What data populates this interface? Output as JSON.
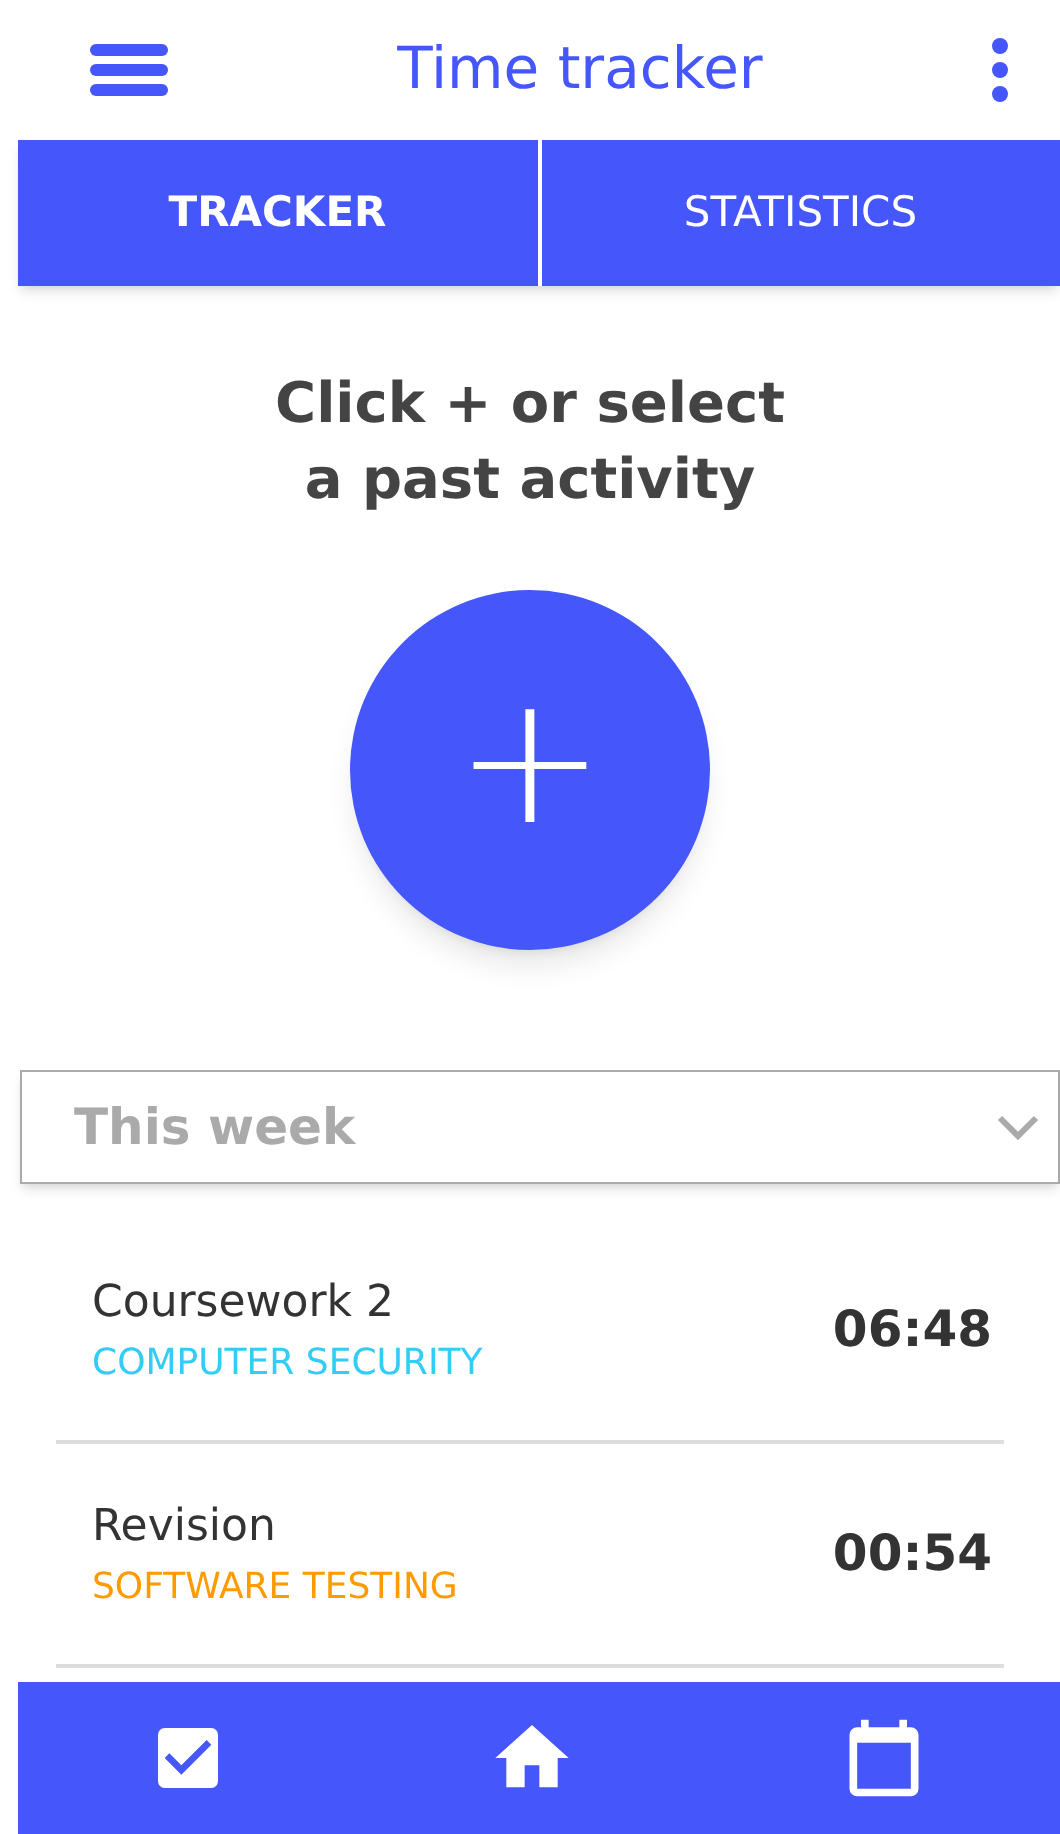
{
  "app_bar": {
    "title": "Time tracker"
  },
  "tabs": [
    {
      "label": "TRACKER",
      "selected": true
    },
    {
      "label": "STATISTICS",
      "selected": false
    }
  ],
  "prompt": "Click + or select\na past activity",
  "add_button": {
    "label": "+"
  },
  "period_select": {
    "value": "This week"
  },
  "activities": [
    {
      "name": "Coursework 2",
      "category": "COMPUTER SECURITY",
      "color": "#33ccf5",
      "duration": "06:48"
    },
    {
      "name": "Revision",
      "category": "SOFTWARE TESTING",
      "color": "#ff9a00",
      "duration": "00:54"
    }
  ],
  "bottom_nav": [
    {
      "kind": "checkbox"
    },
    {
      "kind": "home"
    },
    {
      "kind": "calendar"
    }
  ]
}
